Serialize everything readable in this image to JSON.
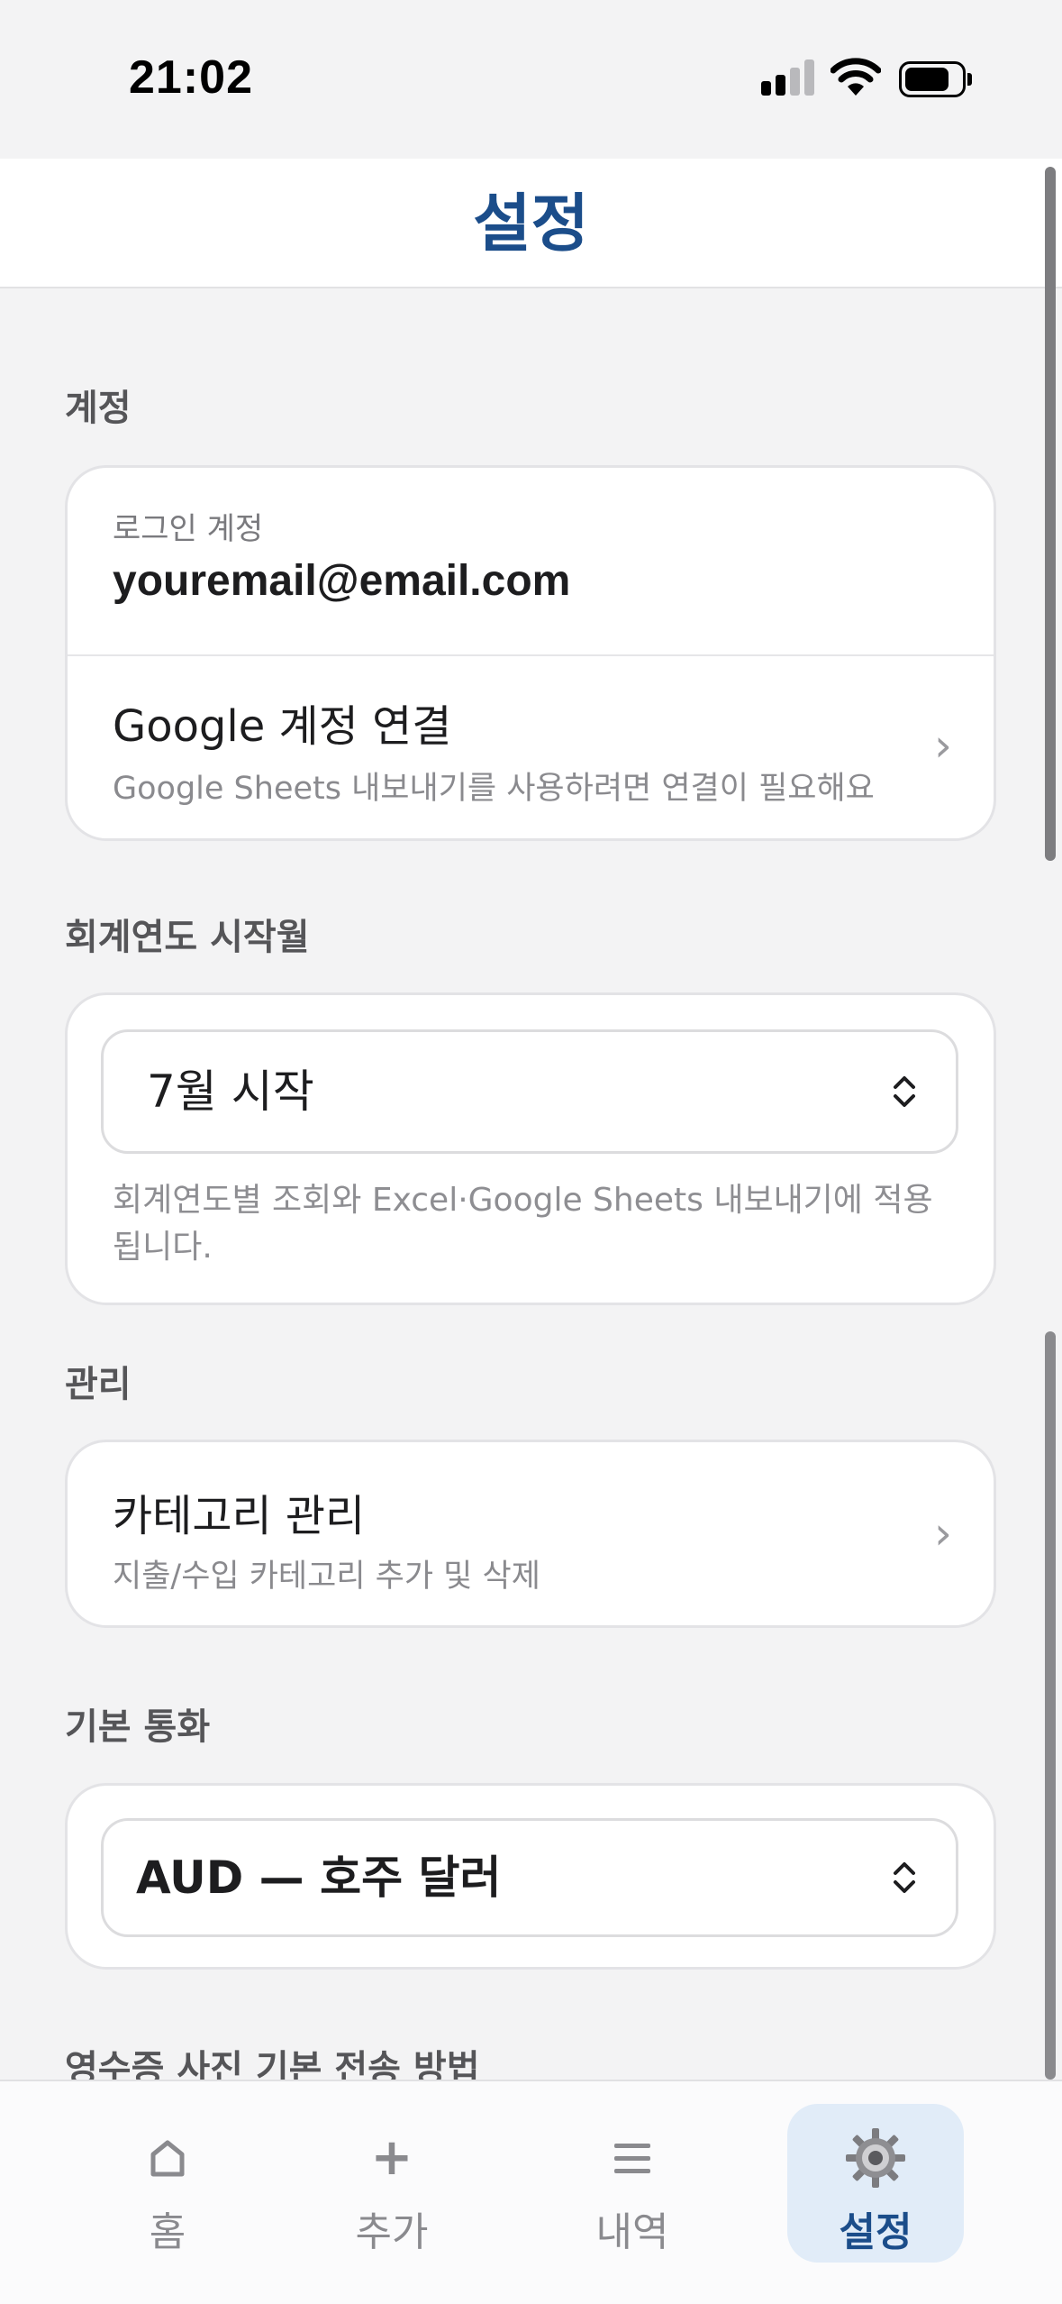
{
  "status_bar": {
    "time": "21:02"
  },
  "header": {
    "title": "설정"
  },
  "account": {
    "section_label": "계정",
    "login_label": "로그인 계정",
    "email": "youremail@email.com",
    "google_title": "Google 계정 연결",
    "google_sub": "Google Sheets 내보내기를 사용하려면 연결이 필요해요",
    "chevron": "›"
  },
  "fiscal": {
    "section_label": "회계연도 시작월",
    "selected": "7월 시작",
    "note": "회계연도별 조회와 Excel·Google Sheets 내보내기에 적용됩니다."
  },
  "manage": {
    "section_label": "관리",
    "category_title": "카테고리 관리",
    "category_sub": "지출/수입 카테고리 추가 및 삭제",
    "chevron": "›"
  },
  "currency": {
    "section_label": "기본 통화",
    "selected": "AUD — 호주 달러"
  },
  "receipt": {
    "section_label": "영수증 사진 기본 전송 방법"
  },
  "nav": {
    "items": [
      {
        "label": "홈",
        "icon": "home-icon"
      },
      {
        "label": "추가",
        "icon": "plus-icon"
      },
      {
        "label": "내역",
        "icon": "list-icon"
      },
      {
        "label": "설정",
        "icon": "gear-icon"
      }
    ],
    "active_index": 3,
    "plus_glyph": "+",
    "list_glyph": "≡"
  },
  "colors": {
    "accent": "#1b4d8a",
    "active_tab_bg": "#e1ecf8",
    "background": "#f3f3f4"
  }
}
